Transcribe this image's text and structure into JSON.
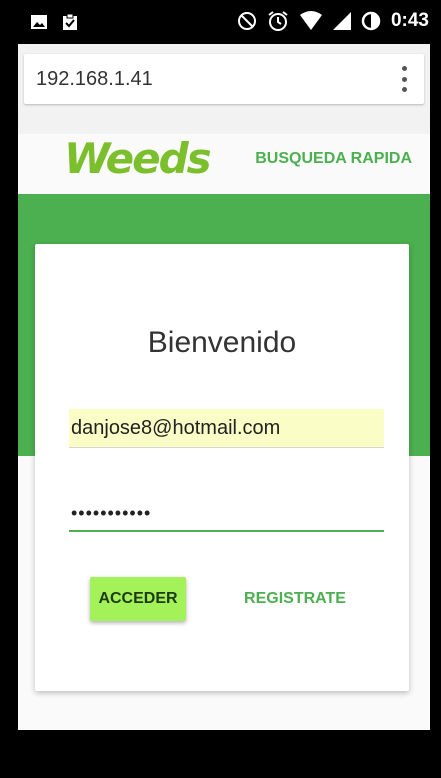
{
  "status_bar": {
    "time": "0:43",
    "icons": [
      "image-icon",
      "clipboard-check-icon",
      "do-not-disturb-icon",
      "alarm-icon",
      "wifi-icon",
      "signal-icon",
      "battery-icon"
    ]
  },
  "browser": {
    "url": "192.168.1.41",
    "menu_icon": "more-vertical-icon"
  },
  "header": {
    "logo": "Weeds",
    "nav_link": "BUSQUEDA RAPIDA",
    "brand_color": "#4caf50",
    "logo_color": "#7cbf2c"
  },
  "login": {
    "title": "Bienvenido",
    "email_value": "danjose8@hotmail.com",
    "password_value": "•••••••••••",
    "acceder_label": "ACCEDER",
    "registrate_label": "REGISTRATE"
  }
}
